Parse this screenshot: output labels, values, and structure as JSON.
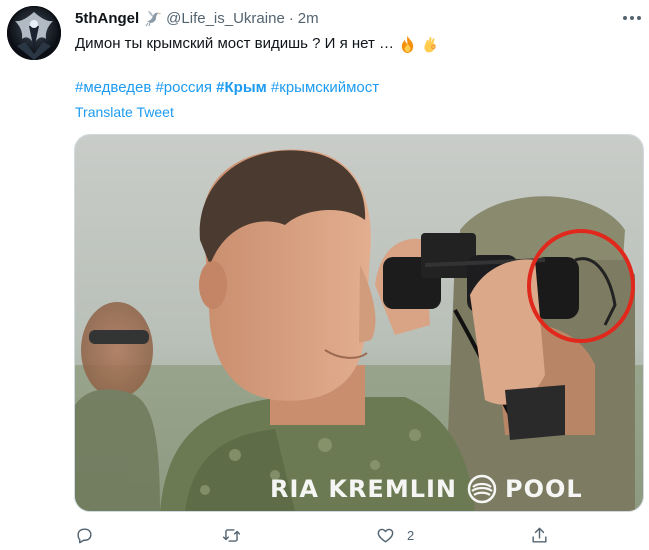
{
  "tweet": {
    "author_name": "5thAngel",
    "author_handle": "@Life_is_Ukraine",
    "separator": "·",
    "timestamp": "2m",
    "text": "Димон ты крымский мост видишь ? И я нет …",
    "emoji": [
      "fire-emoji",
      "ok-hand-emoji"
    ],
    "hashtags": [
      {
        "text": "#медведев",
        "bold": false
      },
      {
        "text": "#россия",
        "bold": false
      },
      {
        "text": "#Крым",
        "bold": true
      },
      {
        "text": "#крымскиймост",
        "bold": false
      }
    ],
    "translate_label": "Translate Tweet"
  },
  "media": {
    "watermark_left": "RIA KREMLIN",
    "watermark_right": "POOL",
    "highlight_color": "#e0281c"
  },
  "actions": {
    "reply": {
      "icon": "reply-icon",
      "count": ""
    },
    "retweet": {
      "icon": "retweet-icon",
      "count": ""
    },
    "like": {
      "icon": "heart-icon",
      "count": "2"
    },
    "share": {
      "icon": "share-icon",
      "count": ""
    }
  },
  "colors": {
    "link": "#1d9bf0",
    "secondary_text": "#536471",
    "primary_text": "#0f1419"
  }
}
